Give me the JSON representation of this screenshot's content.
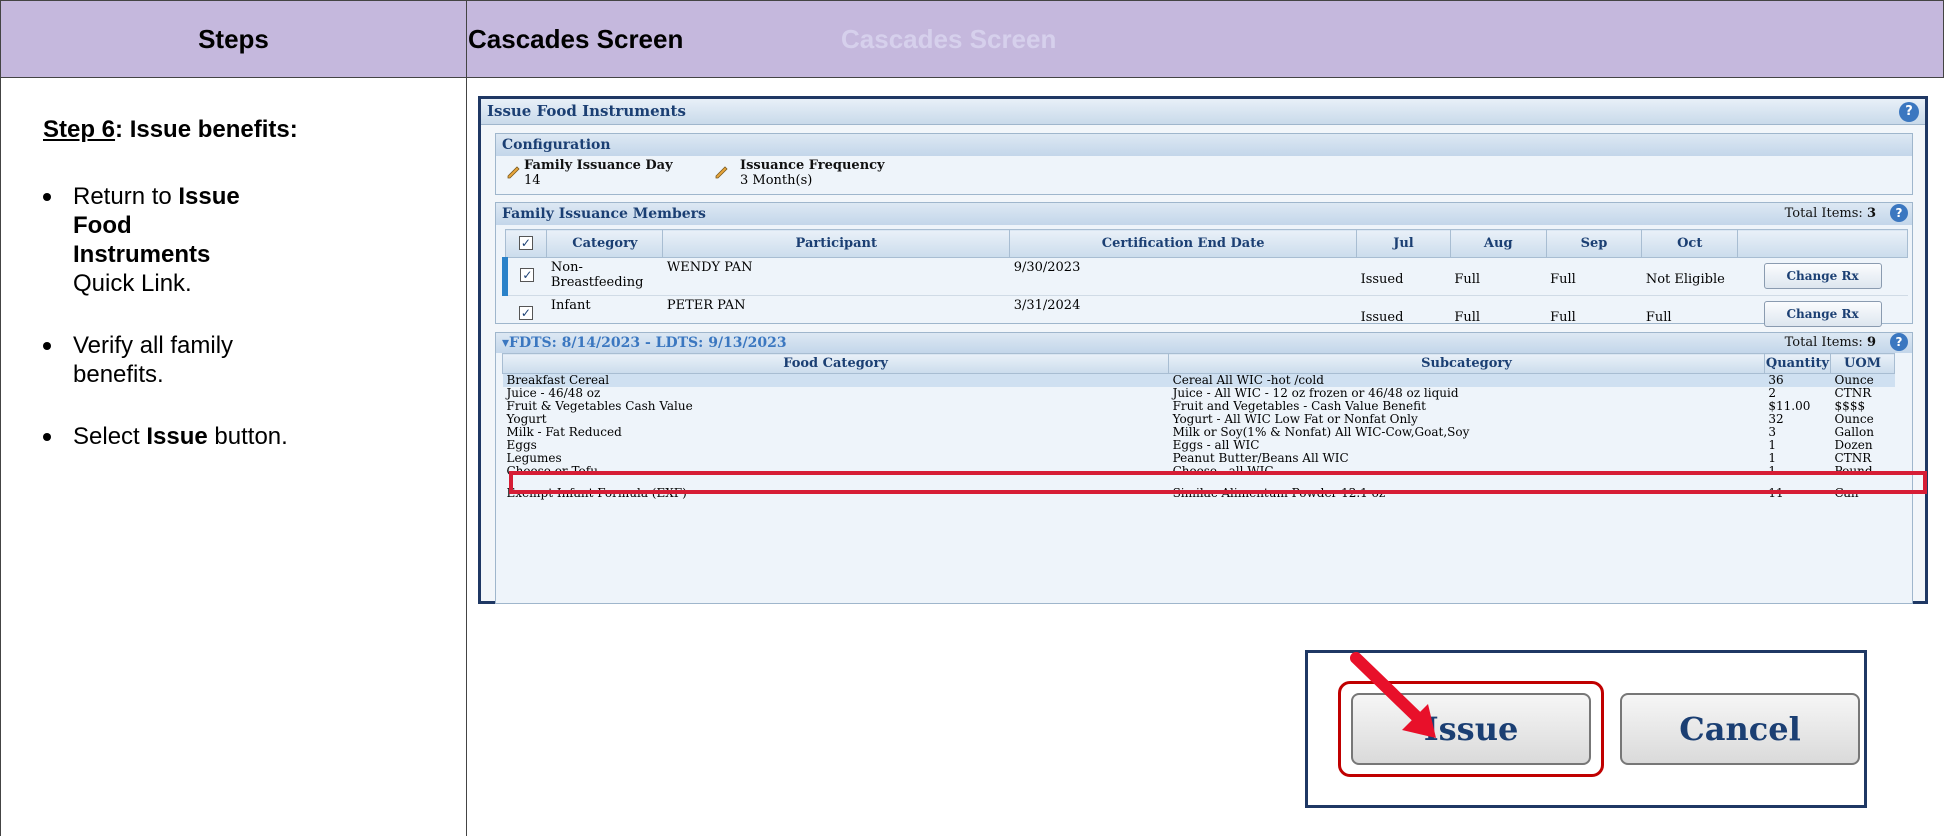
{
  "header": {
    "steps_label": "Steps",
    "screen_label": "Cascades Screen",
    "ghost_label": "Cascades Screen"
  },
  "instructions": {
    "step_num": "Step 6",
    "step_text": ": Issue benefits:",
    "b1_pre": "Return to ",
    "b1_bold": "Issue Food Instruments",
    "b1_post": " Quick Link.",
    "b2": "Verify all family benefits.",
    "b3_pre": "Select ",
    "b3_bold": "Issue",
    "b3_post": " button."
  },
  "app": {
    "title": "Issue Food Instruments",
    "config_title": "Configuration",
    "family_day_label": "Family Issuance Day",
    "family_day_value": "14",
    "freq_label": "Issuance Frequency",
    "freq_value": "3  Month(s)",
    "members_title": "Family Issuance Members",
    "members_total_label": "Total Items:",
    "members_total": "3",
    "member_headers": [
      "Category",
      "Participant",
      "Certification End Date",
      "Jul",
      "Aug",
      "Sep",
      "Oct"
    ],
    "members": [
      {
        "category": "Non-Breastfeeding",
        "participant": "WENDY PAN",
        "cert_end": "9/30/2023",
        "jul": "Issued",
        "aug": "Full",
        "sep": "Full",
        "oct": "Not Eligible",
        "action": "Change Rx"
      },
      {
        "category": "Infant",
        "participant": "PETER PAN",
        "cert_end": "3/31/2024",
        "jul": "Issued",
        "aug": "Full",
        "sep": "Full",
        "oct": "Full",
        "action": "Change Rx"
      }
    ],
    "fdts_title": "▾FDTS: 8/14/2023 - LDTS: 9/13/2023",
    "fdts_total_label": "Total Items:",
    "fdts_total": "9",
    "food_headers": [
      "Food Category",
      "Subcategory",
      "Quantity",
      "UOM"
    ],
    "food_rows": [
      {
        "cat": "Breakfast Cereal",
        "sub": "Cereal All WIC -hot /cold",
        "qty": "36",
        "uom": "Ounce"
      },
      {
        "cat": "Juice - 46/48 oz",
        "sub": "Juice - All WIC - 12 oz frozen or 46/48 oz liquid",
        "qty": "2",
        "uom": "CTNR"
      },
      {
        "cat": "Fruit & Vegetables Cash Value",
        "sub": "Fruit and Vegetables - Cash Value Benefit",
        "qty": "$11.00",
        "uom": "$$$$"
      },
      {
        "cat": "Yogurt",
        "sub": "Yogurt - All WIC Low Fat or Nonfat Only",
        "qty": "32",
        "uom": "Ounce"
      },
      {
        "cat": "Milk - Fat Reduced",
        "sub": "Milk or Soy(1% & Nonfat) All WIC-Cow,Goat,Soy",
        "qty": "3",
        "uom": "Gallon"
      },
      {
        "cat": "Eggs",
        "sub": "Eggs - all WIC",
        "qty": "1",
        "uom": "Dozen"
      },
      {
        "cat": "Legumes",
        "sub": "Peanut Butter/Beans All WIC",
        "qty": "1",
        "uom": "CTNR"
      },
      {
        "cat": "Cheese or Tofu",
        "sub": "Cheese - all WIC",
        "qty": "1",
        "uom": "Pound"
      },
      {
        "cat": "Exempt Infant Formula (EXF)",
        "sub": "Similac Alimentum Powder 12.1 oz",
        "qty": "11",
        "uom": "Can"
      }
    ]
  },
  "buttons": {
    "issue": "Issue",
    "cancel": "Cancel"
  },
  "colors": {
    "header_bg": "#c5b8dd",
    "highlight": "#d61d35",
    "frame": "#1f3864"
  }
}
